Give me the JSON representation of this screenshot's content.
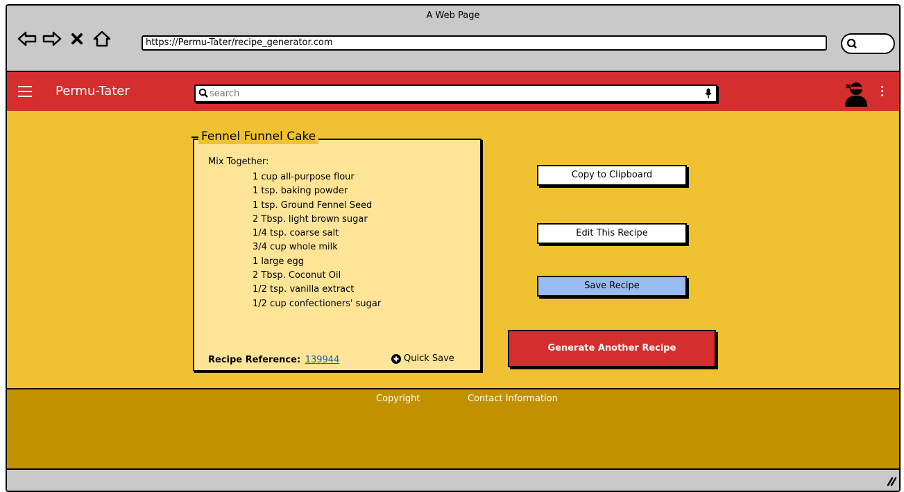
{
  "browser": {
    "title": "A Web Page",
    "url": "https://Permu-Tater/recipe_generator.com"
  },
  "header": {
    "brand": "Permu-Tater",
    "search_placeholder": "search"
  },
  "recipe": {
    "title": "Fennel Funnel Cake",
    "section_label": "Mix Together:",
    "ingredients": [
      "1 cup all-purpose flour",
      "1 tsp. baking powder",
      "1 tsp. Ground Fennel Seed",
      "2 Tbsp. light brown sugar",
      "1/4 tsp. coarse salt",
      "3/4 cup whole milk",
      "1 large egg",
      "2 Tbsp. Coconut Oil",
      "1/2 tsp. vanilla extract",
      "1/2 cup confectioners' sugar"
    ],
    "reference_label": "Recipe Reference:",
    "reference_value": "139944",
    "quick_save_label": "Quick Save"
  },
  "actions": {
    "copy_label": "Copy to Clipboard",
    "edit_label": "Edit This Recipe",
    "save_label": "Save Recipe",
    "generate_label": "Generate Another Recipe"
  },
  "footer": {
    "copyright_label": "Copyright",
    "contact_label": "Contact Information"
  },
  "colors": {
    "header_red": "#d42e2e",
    "main_yellow": "#f0c232",
    "card_yellow": "#fde497",
    "footer_gold": "#c29100",
    "save_blue": "#99bbee"
  },
  "icons": {
    "nav": [
      "back-arrow-icon",
      "forward-arrow-icon",
      "close-icon",
      "home-icon"
    ],
    "search": "search-icon",
    "mic": "microphone-icon",
    "user": "user-avatar-icon",
    "menu": "hamburger-menu-icon",
    "more": "kebab-menu-icon",
    "quick_save": "plus-circle-icon"
  }
}
